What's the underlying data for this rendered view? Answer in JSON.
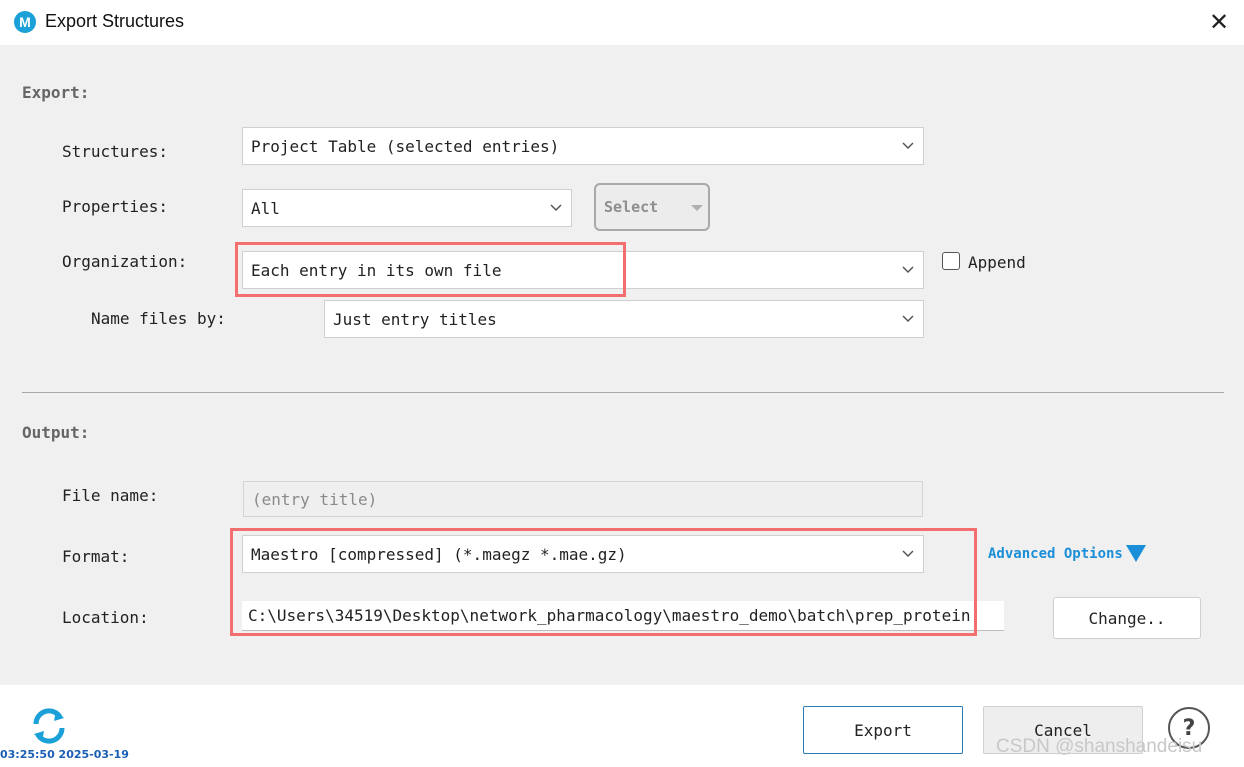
{
  "window": {
    "title": "Export Structures",
    "icon_letter": "M"
  },
  "export_section": {
    "heading": "Export:",
    "structures": {
      "label": "Structures:",
      "value": "Project Table (selected entries)"
    },
    "properties": {
      "label": "Properties:",
      "value": "All",
      "select_label": "Select"
    },
    "organization": {
      "label": "Organization:",
      "value": "Each entry in its own file",
      "append_label": "Append",
      "append_checked": false
    },
    "name_files_by": {
      "label": "Name files by:",
      "value": "Just entry titles"
    }
  },
  "output_section": {
    "heading": "Output:",
    "file_name": {
      "label": "File name:",
      "placeholder": "(entry title)"
    },
    "format": {
      "label": "Format:",
      "value": "Maestro [compressed] (*.maegz *.mae.gz)",
      "advanced_label": "Advanced Options"
    },
    "location": {
      "label": "Location:",
      "value": "C:\\Users\\34519\\Desktop\\network_pharmacology\\maestro_demo\\batch\\prep_protein",
      "change_label": "Change.."
    }
  },
  "footer": {
    "export_label": "Export",
    "cancel_label": "Cancel",
    "help_label": "?",
    "timestamp": "03:25:50 2025-03-19",
    "watermark": "CSDN @shanshandeisu"
  },
  "colors": {
    "accent": "#1ba1d8",
    "highlight": "#f36f6f",
    "link": "#1a8fd8"
  }
}
